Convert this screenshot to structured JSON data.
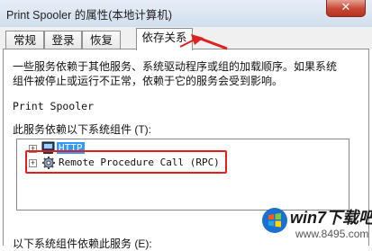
{
  "window": {
    "title": "Print Spooler 的属性(本地计算机)",
    "close_glyph": "✕"
  },
  "tabs": [
    {
      "label": "常规",
      "active": false
    },
    {
      "label": "登录",
      "active": false
    },
    {
      "label": "恢复",
      "active": false
    },
    {
      "label": "依存关系",
      "active": true
    }
  ],
  "panel": {
    "description_line1": "一些服务依赖于其他服务、系统驱动程序或组的加载顺序。如果系统",
    "description_line2": "组件被停止或运行不正常，依赖于它的服务会受到影响。",
    "service_name": "Print Spooler",
    "depends_on_label": "此服务依赖以下系统组件 (T):",
    "tree_items": [
      {
        "label": "HTTP",
        "expander": "+",
        "icon": "system-component-icon",
        "selected": true
      },
      {
        "label": "Remote Procedure Call (RPC)",
        "expander": "+",
        "icon": "gear-icon",
        "selected": false
      }
    ],
    "dependents_label": "以下系统组件依赖此服务 (E):"
  },
  "annotation": {
    "color": "#e02020"
  },
  "watermark": {
    "brand": "win7下载吧",
    "url": "www.8495.com"
  }
}
